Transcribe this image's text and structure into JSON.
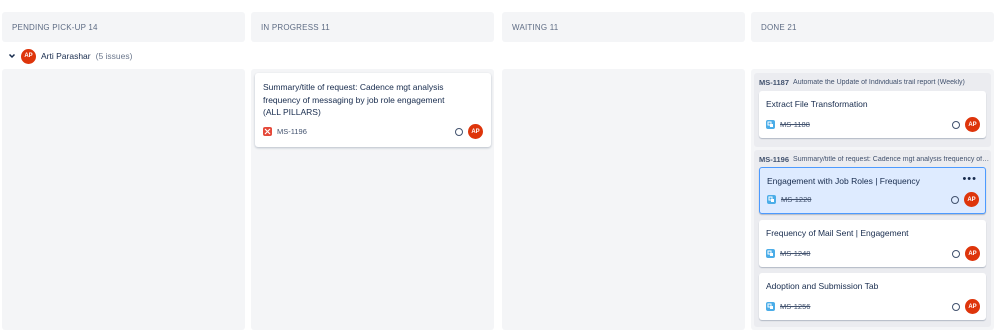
{
  "columns": [
    {
      "title": "PENDING PICK-UP 14"
    },
    {
      "title": "IN PROGRESS 11"
    },
    {
      "title": "WAITING 11"
    },
    {
      "title": "DONE 21"
    }
  ],
  "swimlane": {
    "avatar": "AP",
    "name": "Arti Parashar",
    "count": "(5 issues)",
    "icon": "chevron-down-icon"
  },
  "in_progress_card": {
    "title": "Summary/title of request: Cadence mgt analysis frequency of messaging by job role engagement (ALL PILLARS)",
    "key": "MS-1196",
    "type_icon": "story-icon",
    "avatar": "AP"
  },
  "done": {
    "groups": [
      {
        "key": "MS-1187",
        "summary": "Automate the Update of Individuals trail report (Weekly)",
        "subtasks": [
          {
            "title": "Extract File Transformation",
            "key": "MS-1188",
            "avatar": "AP"
          }
        ]
      },
      {
        "key": "MS-1196",
        "summary": "Summary/title of request: Cadence mgt analysis frequency of messaging by job role engagement (ALL PILLARS)",
        "subtasks": [
          {
            "title": "Engagement with Job Roles | Frequency",
            "key": "MS-1220",
            "avatar": "AP",
            "selected": true,
            "more": "•••"
          },
          {
            "title": "Frequency of Mail Sent | Engagement",
            "key": "MS-1248",
            "avatar": "AP"
          },
          {
            "title": "Adoption and Submission Tab",
            "key": "MS-1256",
            "avatar": "AP"
          }
        ]
      }
    ]
  },
  "colors": {
    "avatar": "#de350b",
    "story": "#e5493a",
    "subtask": "#4bade8",
    "selected": "#deebff"
  }
}
